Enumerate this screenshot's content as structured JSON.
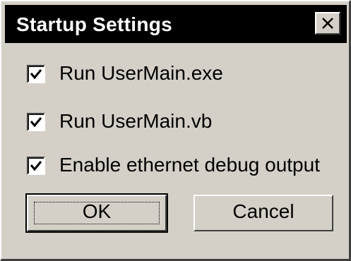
{
  "dialog": {
    "title": "Startup Settings",
    "close_icon": "close-x-icon"
  },
  "options": [
    {
      "label": "Run UserMain.exe",
      "checked": true
    },
    {
      "label": "Run UserMain.vb",
      "checked": true
    },
    {
      "label": "Enable ethernet debug output",
      "checked": true
    }
  ],
  "buttons": {
    "ok_label": "OK",
    "cancel_label": "Cancel"
  },
  "colors": {
    "window_bg": "#d4d0c8",
    "titlebar_bg": "#000000",
    "title_text": "#ffffff"
  }
}
